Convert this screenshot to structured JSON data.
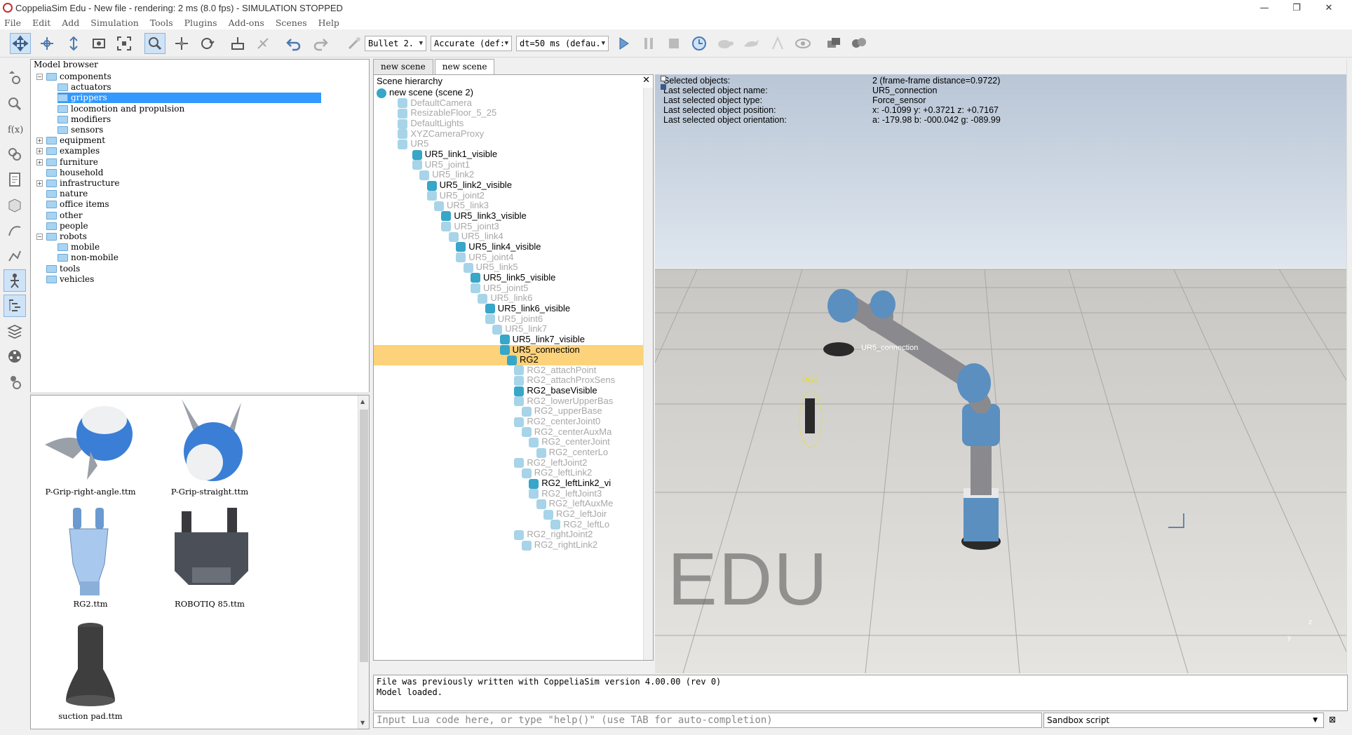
{
  "window": {
    "title": "CoppeliaSim Edu - New file - rendering: 2 ms (8.0 fps) - SIMULATION STOPPED",
    "min": "—",
    "restore": "❐",
    "close": "✕"
  },
  "menu": [
    "File",
    "Edit",
    "Add",
    "Simulation",
    "Tools",
    "Plugins",
    "Add-ons",
    "Scenes",
    "Help"
  ],
  "toolbar": {
    "engine": "Bullet 2.",
    "accuracy": "Accurate (def:",
    "dt": "dt=50 ms (defau."
  },
  "model_browser": {
    "header": "Model browser",
    "items": [
      {
        "label": "components",
        "level": 0,
        "expand": "−"
      },
      {
        "label": "actuators",
        "level": 1,
        "expand": ""
      },
      {
        "label": "grippers",
        "level": 1,
        "expand": "",
        "selected": true
      },
      {
        "label": "locomotion and propulsion",
        "level": 1,
        "expand": ""
      },
      {
        "label": "modifiers",
        "level": 1,
        "expand": ""
      },
      {
        "label": "sensors",
        "level": 1,
        "expand": ""
      },
      {
        "label": "equipment",
        "level": 0,
        "expand": "+"
      },
      {
        "label": "examples",
        "level": 0,
        "expand": "+"
      },
      {
        "label": "furniture",
        "level": 0,
        "expand": "+"
      },
      {
        "label": "household",
        "level": 0,
        "expand": ""
      },
      {
        "label": "infrastructure",
        "level": 0,
        "expand": "+"
      },
      {
        "label": "nature",
        "level": 0,
        "expand": ""
      },
      {
        "label": "office items",
        "level": 0,
        "expand": ""
      },
      {
        "label": "other",
        "level": 0,
        "expand": ""
      },
      {
        "label": "people",
        "level": 0,
        "expand": ""
      },
      {
        "label": "robots",
        "level": 0,
        "expand": "−"
      },
      {
        "label": "mobile",
        "level": 1,
        "expand": ""
      },
      {
        "label": "non-mobile",
        "level": 1,
        "expand": ""
      },
      {
        "label": "tools",
        "level": 0,
        "expand": ""
      },
      {
        "label": "vehicles",
        "level": 0,
        "expand": ""
      }
    ]
  },
  "thumbnails": [
    {
      "label": "P-Grip-right-angle.ttm"
    },
    {
      "label": "P-Grip-straight.ttm"
    },
    {
      "label": "RG2.ttm"
    },
    {
      "label": "ROBOTIQ 85.ttm"
    },
    {
      "label": "suction pad.ttm"
    }
  ],
  "tabs": [
    "new scene",
    "new scene"
  ],
  "scene_hierarchy": {
    "header": "Scene hierarchy",
    "close": "✕",
    "rows": [
      {
        "label": "new scene (scene 2)",
        "indent": 0,
        "dim": false,
        "bold": false
      },
      {
        "label": "DefaultCamera",
        "indent": 1,
        "dim": true
      },
      {
        "label": "ResizableFloor_5_25",
        "indent": 1,
        "dim": true
      },
      {
        "label": "DefaultLights",
        "indent": 1,
        "dim": true
      },
      {
        "label": "XYZCameraProxy",
        "indent": 1,
        "dim": true
      },
      {
        "label": "UR5",
        "indent": 1,
        "dim": true
      },
      {
        "label": "UR5_link1_visible",
        "indent": 2,
        "dim": false
      },
      {
        "label": "UR5_joint1",
        "indent": 2,
        "dim": true
      },
      {
        "label": "UR5_link2",
        "indent": 3,
        "dim": true
      },
      {
        "label": "UR5_link2_visible",
        "indent": 4,
        "dim": false
      },
      {
        "label": "UR5_joint2",
        "indent": 4,
        "dim": true
      },
      {
        "label": "UR5_link3",
        "indent": 5,
        "dim": true
      },
      {
        "label": "UR5_link3_visible",
        "indent": 6,
        "dim": false
      },
      {
        "label": "UR5_joint3",
        "indent": 6,
        "dim": true
      },
      {
        "label": "UR5_link4",
        "indent": 7,
        "dim": true
      },
      {
        "label": "UR5_link4_visible",
        "indent": 8,
        "dim": false
      },
      {
        "label": "UR5_joint4",
        "indent": 8,
        "dim": true
      },
      {
        "label": "UR5_link5",
        "indent": 9,
        "dim": true
      },
      {
        "label": "UR5_link5_visible",
        "indent": 10,
        "dim": false
      },
      {
        "label": "UR5_joint5",
        "indent": 10,
        "dim": true
      },
      {
        "label": "UR5_link6",
        "indent": 11,
        "dim": true
      },
      {
        "label": "UR5_link6_visible",
        "indent": 12,
        "dim": false
      },
      {
        "label": "UR5_joint6",
        "indent": 12,
        "dim": true
      },
      {
        "label": "UR5_link7",
        "indent": 13,
        "dim": true
      },
      {
        "label": "UR5_link7_visible",
        "indent": 14,
        "dim": false
      },
      {
        "label": "UR5_connection",
        "indent": 14,
        "dim": false,
        "selected": true
      },
      {
        "label": "RG2",
        "indent": 15,
        "dim": false,
        "selected": true
      },
      {
        "label": "RG2_attachPoint",
        "indent": 16,
        "dim": true
      },
      {
        "label": "RG2_attachProxSens",
        "indent": 16,
        "dim": true
      },
      {
        "label": "RG2_baseVisible",
        "indent": 16,
        "dim": false
      },
      {
        "label": "RG2_lowerUpperBas",
        "indent": 16,
        "dim": true
      },
      {
        "label": "RG2_upperBase",
        "indent": 17,
        "dim": true
      },
      {
        "label": "RG2_centerJoint0",
        "indent": 16,
        "dim": true
      },
      {
        "label": "RG2_centerAuxMa",
        "indent": 17,
        "dim": true
      },
      {
        "label": "RG2_centerJoint",
        "indent": 18,
        "dim": true
      },
      {
        "label": "RG2_centerLo",
        "indent": 19,
        "dim": true
      },
      {
        "label": "RG2_leftJoint2",
        "indent": 16,
        "dim": true
      },
      {
        "label": "RG2_leftLink2",
        "indent": 17,
        "dim": true
      },
      {
        "label": "RG2_leftLink2_vi",
        "indent": 18,
        "dim": false
      },
      {
        "label": "RG2_leftJoint3",
        "indent": 18,
        "dim": true
      },
      {
        "label": "RG2_leftAuxMe",
        "indent": 19,
        "dim": true
      },
      {
        "label": "RG2_leftJoir",
        "indent": 20,
        "dim": true
      },
      {
        "label": "RG2_leftLo",
        "indent": 21,
        "dim": true
      },
      {
        "label": "RG2_rightJoint2",
        "indent": 16,
        "dim": true
      },
      {
        "label": "RG2_rightLink2",
        "indent": 17,
        "dim": true
      }
    ]
  },
  "selection_info": {
    "labels": [
      "Selected objects:",
      "Last selected object name:",
      "Last selected object type:",
      "Last selected object position:",
      "Last selected object orientation:"
    ],
    "values": [
      "2 (frame-frame distance=0.9722)",
      "UR5_connection",
      "Force_sensor",
      "x: -0.1099    y: +0.3721    z: +0.7167",
      "a: -179.98    b: -000.042    g: -089.99"
    ]
  },
  "viewport": {
    "watermark": "EDU",
    "label_connection": "UR5_connection",
    "label_rg2": "RG2",
    "axis_y": "y",
    "axis_z": "z"
  },
  "console": {
    "lines": [
      "File was previously written with CoppeliaSim version 4.00.00 (rev 0)",
      "Model loaded."
    ]
  },
  "lua_input": {
    "placeholder": "Input Lua code here, or type \"help()\" (use TAB for auto-completion)"
  },
  "script_select": {
    "value": "Sandbox script"
  }
}
